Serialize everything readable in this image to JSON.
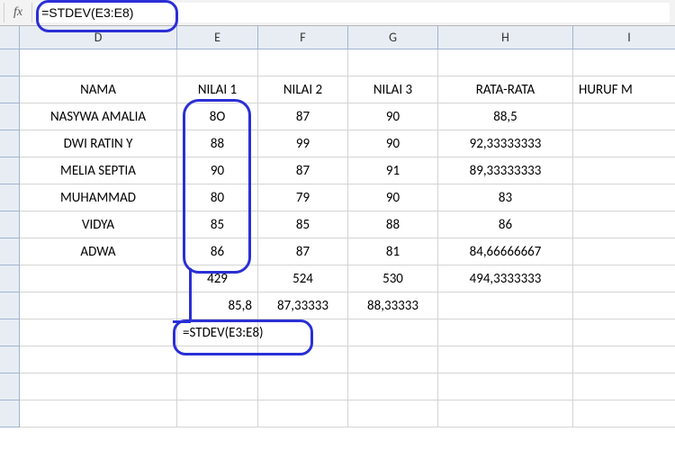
{
  "formula_bar": {
    "fx_label": "fx",
    "formula": "=STDEV(E3:E8)"
  },
  "columns": [
    "",
    "D",
    "E",
    "F",
    "G",
    "H",
    "I"
  ],
  "row_nums": [
    "",
    "",
    "",
    "",
    "",
    "",
    "",
    "",
    "",
    "",
    "",
    "",
    "",
    "",
    ""
  ],
  "headers": {
    "nama": "NAMA",
    "nilai1": "NILAI 1",
    "nilai2": "NILAI 2",
    "nilai3": "NILAI 3",
    "rata": "RATA-RATA",
    "huruf": "HURUF M"
  },
  "rows": [
    {
      "n": "",
      "d": "NASYWA AMALIA",
      "e": "8O",
      "f": "87",
      "g": "90",
      "h": "88,5"
    },
    {
      "n": "",
      "d": "DWI RATIN Y",
      "e": "88",
      "f": "99",
      "g": "90",
      "h": "92,33333333"
    },
    {
      "n": "",
      "d": "MELIA SEPTIA",
      "e": "90",
      "f": "87",
      "g": "91",
      "h": "89,33333333"
    },
    {
      "n": "",
      "d": "MUHAMMAD",
      "e": "80",
      "f": "79",
      "g": "90",
      "h": "83"
    },
    {
      "n": "",
      "d": "VIDYA",
      "e": "85",
      "f": "85",
      "g": "88",
      "h": "86"
    },
    {
      "n": "",
      "d": "ADWA",
      "e": "86",
      "f": "87",
      "g": "81",
      "h": "84,66666667"
    }
  ],
  "sum_row": {
    "e": "429",
    "f": "524",
    "g": "530",
    "h": "494,3333333"
  },
  "avg_row": {
    "e": "85,8",
    "f": "87,33333",
    "g": "88,33333"
  },
  "stdev_cell": "=STDEV(E3:E8)",
  "chart_data": {
    "type": "table",
    "title": "",
    "columns": [
      "NAMA",
      "NILAI 1",
      "NILAI 2",
      "NILAI 3",
      "RATA-RATA"
    ],
    "rows": [
      [
        "NASYWA AMALIA",
        80,
        87,
        90,
        88.5
      ],
      [
        "DWI RATIN Y",
        88,
        99,
        90,
        92.33333333
      ],
      [
        "MELIA SEPTIA",
        90,
        87,
        91,
        89.33333333
      ],
      [
        "MUHAMMAD",
        80,
        79,
        90,
        83
      ],
      [
        "VIDYA",
        85,
        85,
        88,
        86
      ],
      [
        "ADWA",
        86,
        87,
        81,
        84.66666667
      ]
    ],
    "sums": [
      429,
      524,
      530,
      494.3333333
    ],
    "averages": [
      85.8,
      87.33333,
      88.33333
    ]
  }
}
